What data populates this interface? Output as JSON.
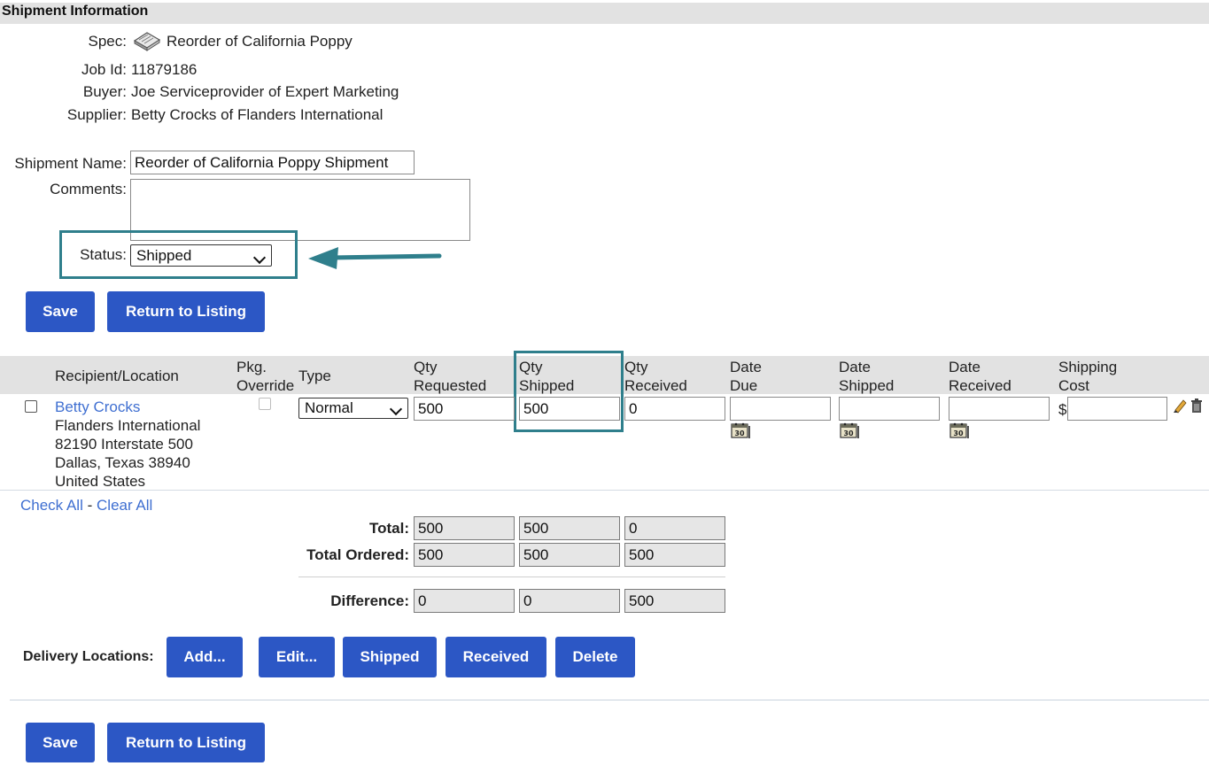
{
  "header": {
    "title": "Shipment Information"
  },
  "info": {
    "spec_label": "Spec:",
    "spec_value": "Reorder of California Poppy",
    "job_id_label": "Job Id:",
    "job_id_value": "11879186",
    "buyer_label": "Buyer:",
    "buyer_value": "Joe Serviceprovider of Expert Marketing",
    "supplier_label": "Supplier:",
    "supplier_value": "Betty Crocks of Flanders International"
  },
  "form": {
    "shipment_name_label": "Shipment Name:",
    "shipment_name_value": "Reorder of California Poppy Shipment",
    "comments_label": "Comments:",
    "comments_value": "",
    "status_label": "Status:",
    "status_value": "Shipped"
  },
  "buttons": {
    "save": "Save",
    "return": "Return to Listing",
    "add": "Add...",
    "edit": "Edit...",
    "shipped": "Shipped",
    "received": "Received",
    "delete": "Delete"
  },
  "table": {
    "headers": {
      "recipient": "Recipient/Location",
      "pkg_override_1": "Pkg.",
      "pkg_override_2": "Override",
      "type": "Type",
      "qty_requested_1": "Qty",
      "qty_requested_2": "Requested",
      "qty_shipped_1": "Qty",
      "qty_shipped_2": "Shipped",
      "qty_received_1": "Qty",
      "qty_received_2": "Received",
      "date_due_1": "Date",
      "date_due_2": "Due",
      "date_shipped_1": "Date",
      "date_shipped_2": "Shipped",
      "date_received_1": "Date",
      "date_received_2": "Received",
      "shipping_cost_1": "Shipping",
      "shipping_cost_2": "Cost"
    },
    "row": {
      "recipient_name": "Betty Crocks",
      "address_1": "Flanders International",
      "address_2": "82190 Interstate 500",
      "address_3": "Dallas, Texas 38940",
      "address_4": "United States",
      "type": "Normal",
      "qty_requested": "500",
      "qty_shipped": "500",
      "qty_received": "0",
      "date_due": "",
      "date_shipped": "",
      "date_received": "",
      "currency": "$",
      "shipping_cost": ""
    }
  },
  "selection": {
    "check_all": "Check All",
    "separator": "-",
    "clear_all": "Clear All"
  },
  "totals": {
    "total_label": "Total:",
    "total": [
      "500",
      "500",
      "0"
    ],
    "total_ordered_label": "Total Ordered:",
    "total_ordered": [
      "500",
      "500",
      "500"
    ],
    "difference_label": "Difference:",
    "difference": [
      "0",
      "0",
      "500"
    ]
  },
  "delivery": {
    "label": "Delivery Locations:"
  },
  "colors": {
    "accent": "#2c57c5",
    "highlight": "#2f7f8c",
    "header_bg": "#e2e2e2",
    "link": "#3f6fd1"
  }
}
